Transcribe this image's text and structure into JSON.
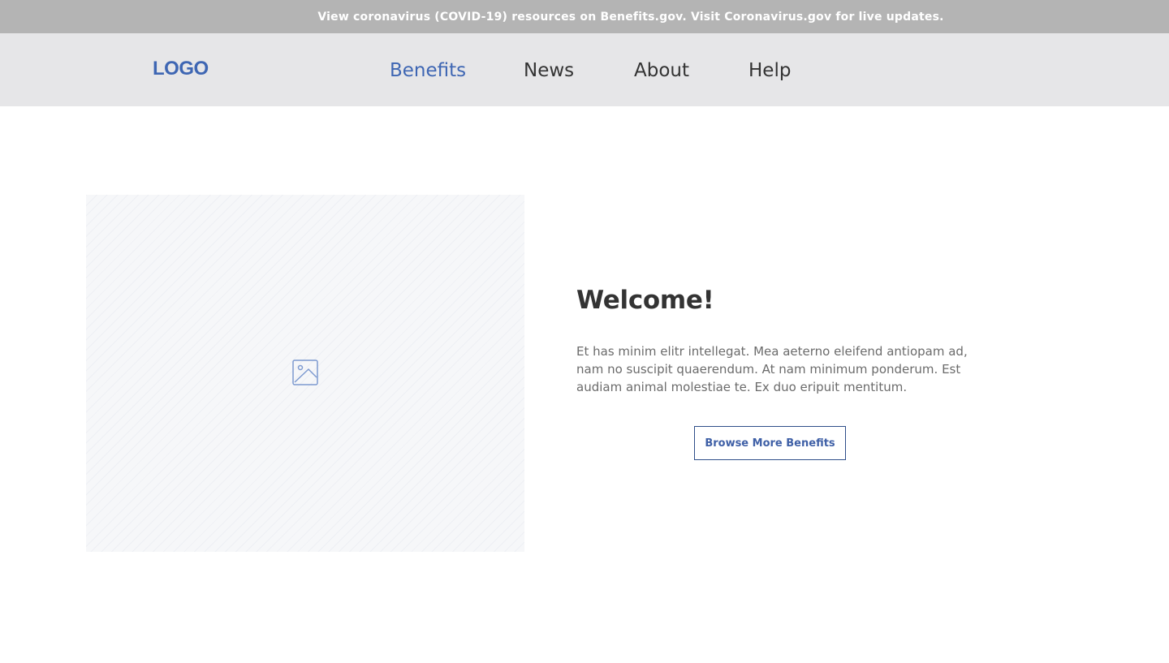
{
  "alert": {
    "text": "View coronavirus (COVID-19) resources on Benefits.gov. Visit Coronavirus.gov for live updates."
  },
  "header": {
    "logo": "LOGO",
    "nav": [
      {
        "label": "Benefits",
        "active": true
      },
      {
        "label": "News",
        "active": false
      },
      {
        "label": "About",
        "active": false
      },
      {
        "label": "Help",
        "active": false
      }
    ]
  },
  "hero": {
    "image_icon": "image-placeholder-icon",
    "title": "Welcome!",
    "body": "Et has minim elitr intellegat. Mea aeterno eleifend antiopam ad, nam no suscipit quaerendum. At nam minimum ponderum. Est audiam animal molestiae te. Ex duo eripuit mentitum.",
    "button_label": "Browse More Benefits"
  },
  "colors": {
    "accent": "#3e66b3",
    "alert_bg": "#b4b4b4",
    "header_bg": "#e6e6e8",
    "text": "#333333"
  }
}
